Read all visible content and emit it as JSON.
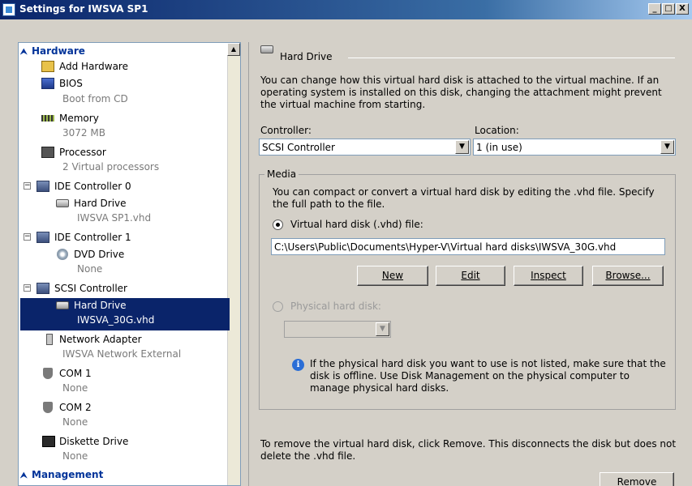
{
  "window": {
    "title": "Settings for IWSVA SP1",
    "controls": {
      "minimize": "_",
      "maximize": "□",
      "close": "X"
    }
  },
  "tree": {
    "hardware_header": "Hardware",
    "management_header": "Management",
    "items": [
      {
        "label": "Add Hardware",
        "sub": "",
        "icon": "add-hardware-icon"
      },
      {
        "label": "BIOS",
        "sub": "Boot from CD",
        "icon": "bios-icon"
      },
      {
        "label": "Memory",
        "sub": "3072 MB",
        "icon": "memory-icon"
      },
      {
        "label": "Processor",
        "sub": "2 Virtual processors",
        "icon": "processor-icon"
      },
      {
        "label": "IDE Controller 0",
        "sub": "",
        "icon": "ide-controller-icon"
      },
      {
        "label": "Hard Drive",
        "sub": "IWSVA SP1.vhd",
        "icon": "hard-drive-icon"
      },
      {
        "label": "IDE Controller 1",
        "sub": "",
        "icon": "ide-controller-icon"
      },
      {
        "label": "DVD Drive",
        "sub": "None",
        "icon": "dvd-drive-icon"
      },
      {
        "label": "SCSI Controller",
        "sub": "",
        "icon": "scsi-controller-icon"
      },
      {
        "label": "Hard Drive",
        "sub": "IWSVA_30G.vhd",
        "icon": "hard-drive-icon",
        "selected": true
      },
      {
        "label": "Network Adapter",
        "sub": "IWSVA Network External",
        "icon": "network-adapter-icon"
      },
      {
        "label": "COM 1",
        "sub": "None",
        "icon": "com-port-icon"
      },
      {
        "label": "COM 2",
        "sub": "None",
        "icon": "com-port-icon"
      },
      {
        "label": "Diskette Drive",
        "sub": "None",
        "icon": "diskette-drive-icon"
      }
    ]
  },
  "panel": {
    "section_title": "Hard Drive",
    "description": "You can change how this virtual hard disk is attached to the virtual machine. If an operating system is installed on this disk, changing the attachment might prevent the virtual machine from starting.",
    "controller_label": "Controller:",
    "controller_value": "SCSI Controller",
    "location_label": "Location:",
    "location_value": "1 (in use)",
    "media": {
      "title": "Media",
      "description": "You can compact or convert a virtual hard disk by editing the .vhd file. Specify the full path to the file.",
      "virtual_option": "Virtual hard disk (.vhd) file:",
      "path": "C:\\Users\\Public\\Documents\\Hyper-V\\Virtual hard disks\\IWSVA_30G.vhd",
      "buttons": {
        "new": "New",
        "edit": "Edit",
        "inspect": "Inspect",
        "browse": "Browse..."
      },
      "physical_option": "Physical hard disk:",
      "physical_value": "",
      "info": "If the physical hard disk you want to use is not listed, make sure that the disk is offline. Use Disk Management on the physical computer to manage physical hard disks."
    },
    "remove_note": "To remove the virtual hard disk, click Remove. This disconnects the disk but does not delete the .vhd file.",
    "remove_button": "Remove"
  }
}
